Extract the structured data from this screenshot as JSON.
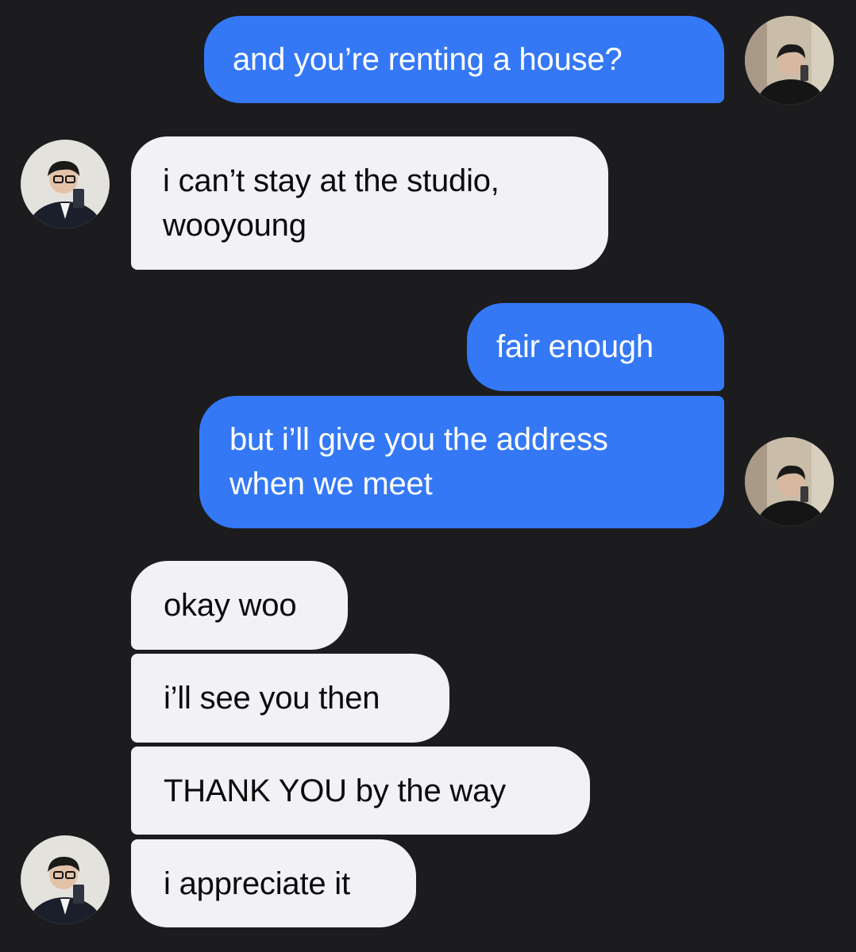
{
  "conversation": {
    "messages": [
      {
        "sender": "me",
        "text": "and you’re renting a house?"
      },
      {
        "sender": "them",
        "text": "i can’t stay at the studio,\nwooyoung"
      },
      {
        "sender": "me",
        "text": "fair enough"
      },
      {
        "sender": "me",
        "text": "but i’ll give you the address\nwhen we meet"
      },
      {
        "sender": "them",
        "text": "okay woo"
      },
      {
        "sender": "them",
        "text": "i’ll see you then"
      },
      {
        "sender": "them",
        "text": "THANK YOU by the way"
      },
      {
        "sender": "them",
        "text": "i appreciate it"
      }
    ]
  },
  "colors": {
    "background": "#1c1c1e",
    "sent_bubble": "#3478f6",
    "received_bubble": "#f1f1f6",
    "sent_text": "#ffffff",
    "received_text": "#0b0b0b"
  },
  "avatars": {
    "me": "avatar-photo-selfie-dark-shirt",
    "them": "avatar-photo-selfie-suit-glasses"
  }
}
